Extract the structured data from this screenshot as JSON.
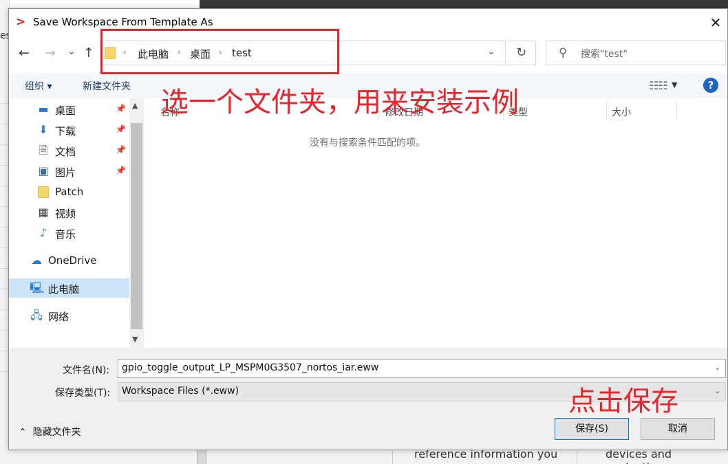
{
  "background": {
    "left_fragment": "es",
    "bottom_text_1": "reference information you",
    "bottom_text_2": "devices and evaluation"
  },
  "dialog": {
    "title": "Save Workspace From Template As",
    "app_icon": "iar-chevron-icon",
    "close_icon": "close-icon"
  },
  "nav": {
    "back_icon": "←",
    "forward_icon": "→",
    "recent_icon": "⌄",
    "up_icon": "↑",
    "breadcrumbs": [
      "此电脑",
      "桌面",
      "test"
    ],
    "search_placeholder": "搜索\"test\""
  },
  "toolbar": {
    "organize": "组织 ▾",
    "new_folder": "新建文件夹"
  },
  "sidebar": {
    "items": [
      {
        "label": "桌面",
        "icon": "desktop-icon",
        "pinned": true
      },
      {
        "label": "下载",
        "icon": "download-icon",
        "pinned": true
      },
      {
        "label": "文档",
        "icon": "document-icon",
        "pinned": true
      },
      {
        "label": "图片",
        "icon": "picture-icon",
        "pinned": true
      },
      {
        "label": "Patch",
        "icon": "folder-icon",
        "pinned": false
      },
      {
        "label": "视频",
        "icon": "video-icon",
        "pinned": false
      },
      {
        "label": "音乐",
        "icon": "music-icon",
        "pinned": false
      },
      {
        "label": "OneDrive",
        "icon": "cloud-icon",
        "pinned": false
      },
      {
        "label": "此电脑",
        "icon": "computer-icon",
        "pinned": false,
        "selected": true
      },
      {
        "label": "网络",
        "icon": "network-icon",
        "pinned": false
      }
    ]
  },
  "filelist": {
    "columns": [
      "名称",
      "修改日期",
      "类型",
      "大小"
    ],
    "empty_message": "没有与搜索条件匹配的项。"
  },
  "form": {
    "filename_label": "文件名(N):",
    "filename_value": "gpio_toggle_output_LP_MSPM0G3507_nortos_iar.eww",
    "filetype_label": "保存类型(T):",
    "filetype_value": "Workspace Files (*.eww)",
    "hide_folders": "隐藏文件夹",
    "save_button": "保存(S)",
    "cancel_button": "取消"
  },
  "annotations": {
    "select_folder": "选一个文件夹，用来安装示例",
    "click_save": "点击保存",
    "color": "#e8242c"
  }
}
